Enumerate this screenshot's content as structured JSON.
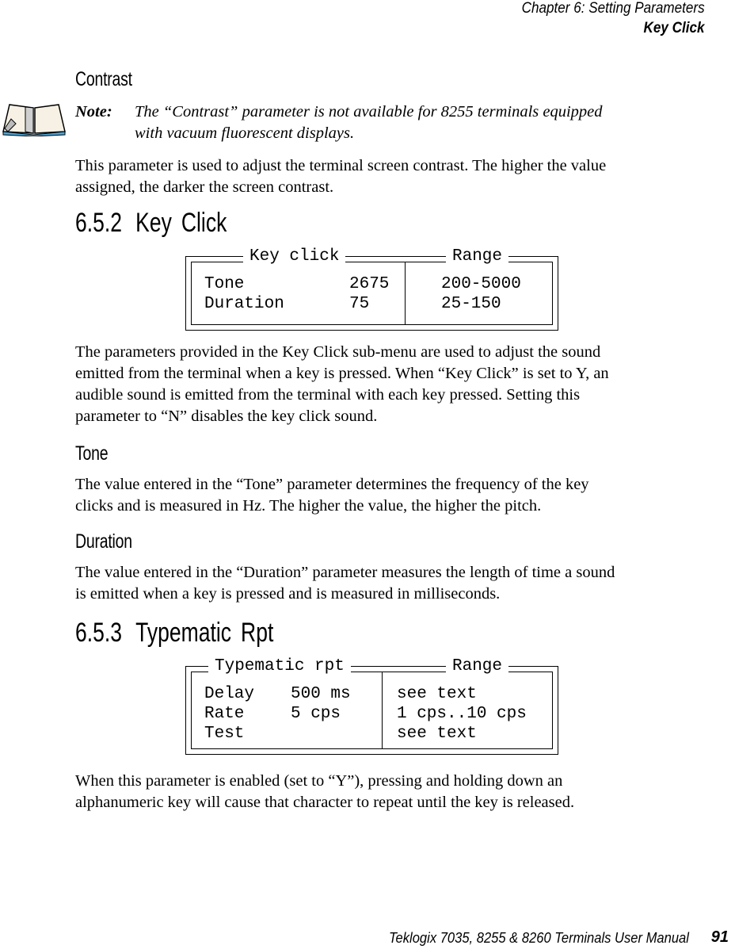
{
  "header": {
    "chapter": "Chapter  6:  Setting Parameters",
    "section": "Key Click"
  },
  "contrast": {
    "heading": "Contrast",
    "note_label": "Note:",
    "note_text_line1": "The “Contrast” parameter is not available for 8255 terminals equipped",
    "note_text_line2": "with vacuum fluorescent displays.",
    "body_line1": "This parameter is used to adjust the terminal screen contrast. The higher the value",
    "body_line2": "assigned, the darker the screen contrast."
  },
  "key_click": {
    "number": "6.5.2",
    "title": "Key Click",
    "screen": {
      "left_title": "Key click",
      "right_title": "Range",
      "rows": [
        {
          "label": "Tone",
          "value": "2675",
          "range": "200-5000"
        },
        {
          "label": "Duration",
          "value": "75",
          "range": "25-150"
        }
      ]
    },
    "body_lines": [
      "The parameters provided in the Key Click sub-menu are used to adjust the sound",
      "emitted from the terminal when a key is pressed. When “Key Click” is set to Y, an",
      "audible sound is emitted from the terminal with each key pressed. Setting this",
      "parameter to “N” disables the key click sound."
    ]
  },
  "tone": {
    "heading": "Tone",
    "body_lines": [
      "The value entered in the “Tone” parameter determines the frequency of the key",
      "clicks and is measured in Hz. The higher the value, the higher the pitch."
    ]
  },
  "duration": {
    "heading": "Duration",
    "body_lines": [
      "The value entered in the “Duration” parameter measures the length of time a sound",
      "is emitted when a key is pressed and is measured in milliseconds."
    ]
  },
  "typematic": {
    "number": "6.5.3",
    "title": "Typematic Rpt",
    "screen": {
      "left_title": "Typematic rpt",
      "right_title": "Range",
      "rows": [
        {
          "label": "Delay",
          "value": "500 ms",
          "range": "see text"
        },
        {
          "label": "Rate",
          "value": "5 cps",
          "range": "1 cps..10 cps"
        },
        {
          "label": "Test",
          "value": "",
          "range": "see text"
        }
      ]
    },
    "body_lines": [
      "When this parameter is enabled (set to “Y”), pressing and holding down an",
      "alphanumeric key will cause that character to repeat until the key is released."
    ]
  },
  "footer": {
    "manual_title": "Teklogix 7035, 8255 & 8260 Terminals User Manual",
    "page_number": "91"
  },
  "icons": {
    "note": "open-book-icon"
  }
}
